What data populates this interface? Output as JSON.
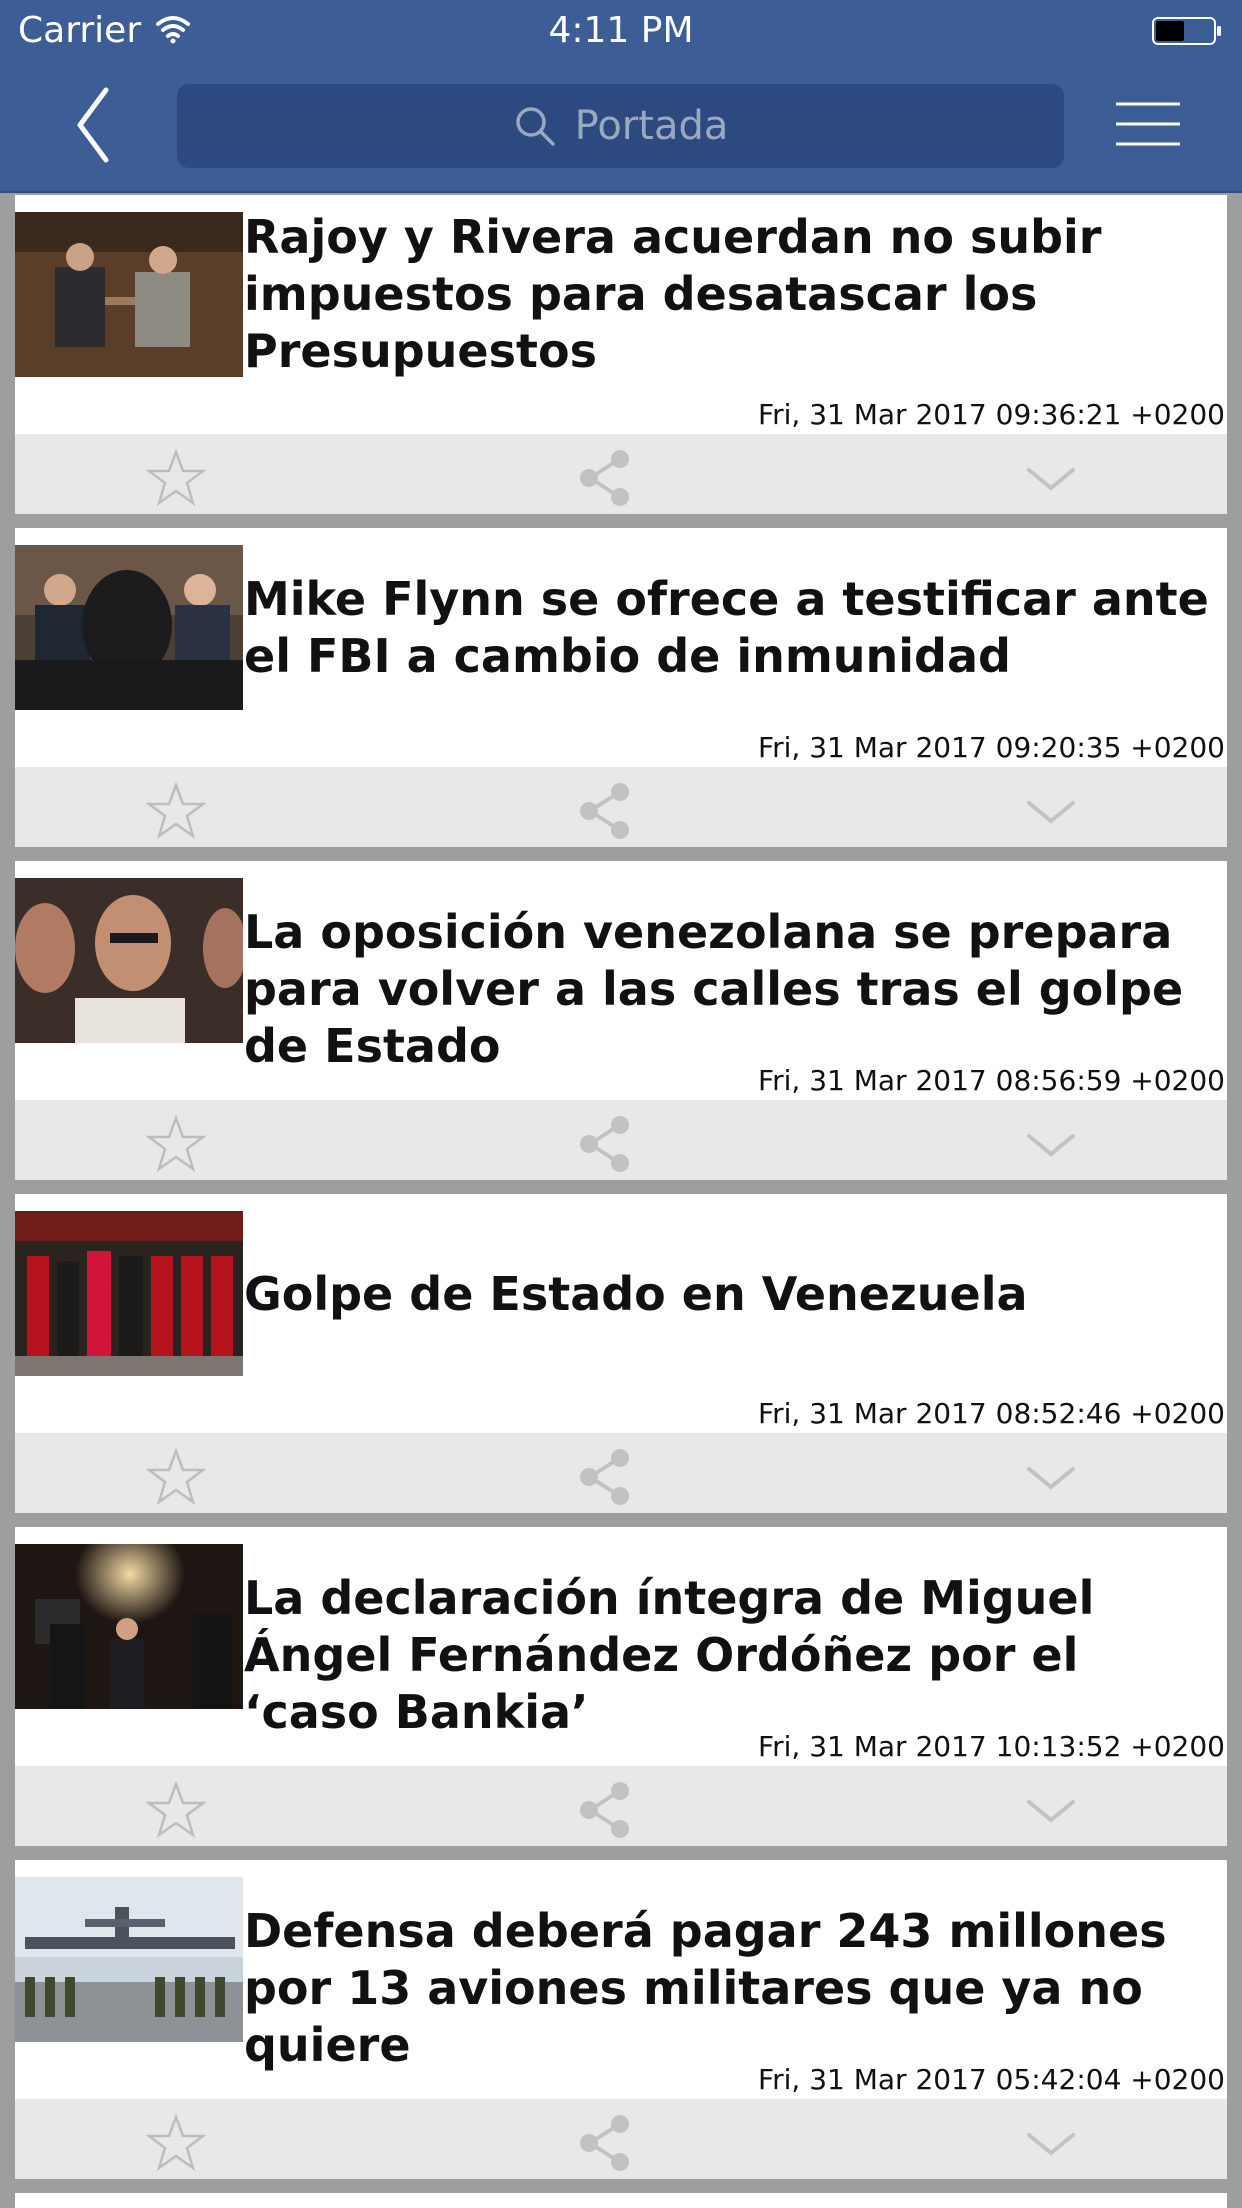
{
  "status_bar": {
    "carrier": "Carrier",
    "time": "4:11 PM"
  },
  "nav": {
    "search_placeholder": "Portada"
  },
  "articles": [
    {
      "title": "Rajoy y Rivera acuerdan no subir impuestos para desatascar los Presupuestos",
      "date": "Fri, 31 Mar 2017 09:36:21 +0200"
    },
    {
      "title": "Mike Flynn se ofrece a testificar ante el FBI a cambio de inmunidad",
      "date": "Fri, 31 Mar 2017 09:20:35 +0200"
    },
    {
      "title": "La oposición venezolana se prepara para volver a las calles tras el golpe de Estado",
      "date": "Fri, 31 Mar 2017 08:56:59 +0200"
    },
    {
      "title": "Golpe de Estado en Venezuela",
      "date": "Fri, 31 Mar 2017 08:52:46 +0200"
    },
    {
      "title": "La declaración íntegra de Miguel Ángel Fernández Ordóñez por el ‘caso Bankia’",
      "date": "Fri, 31 Mar 2017 10:13:52 +0200"
    },
    {
      "title": "Defensa deberá pagar 243 millones por 13 aviones militares que ya no quiere",
      "date": "Fri, 31 Mar 2017 05:42:04 +0200"
    }
  ],
  "icons": {
    "back": "chevron-left-icon",
    "search": "search-icon",
    "menu": "hamburger-menu-icon",
    "favorite": "star-icon",
    "share": "share-icon",
    "expand": "chevron-down-icon"
  },
  "colors": {
    "nav_background": "#3d5d96",
    "search_background": "#2d4a80",
    "list_background": "#9e9e9e",
    "action_bar": "#e8e8e8"
  }
}
